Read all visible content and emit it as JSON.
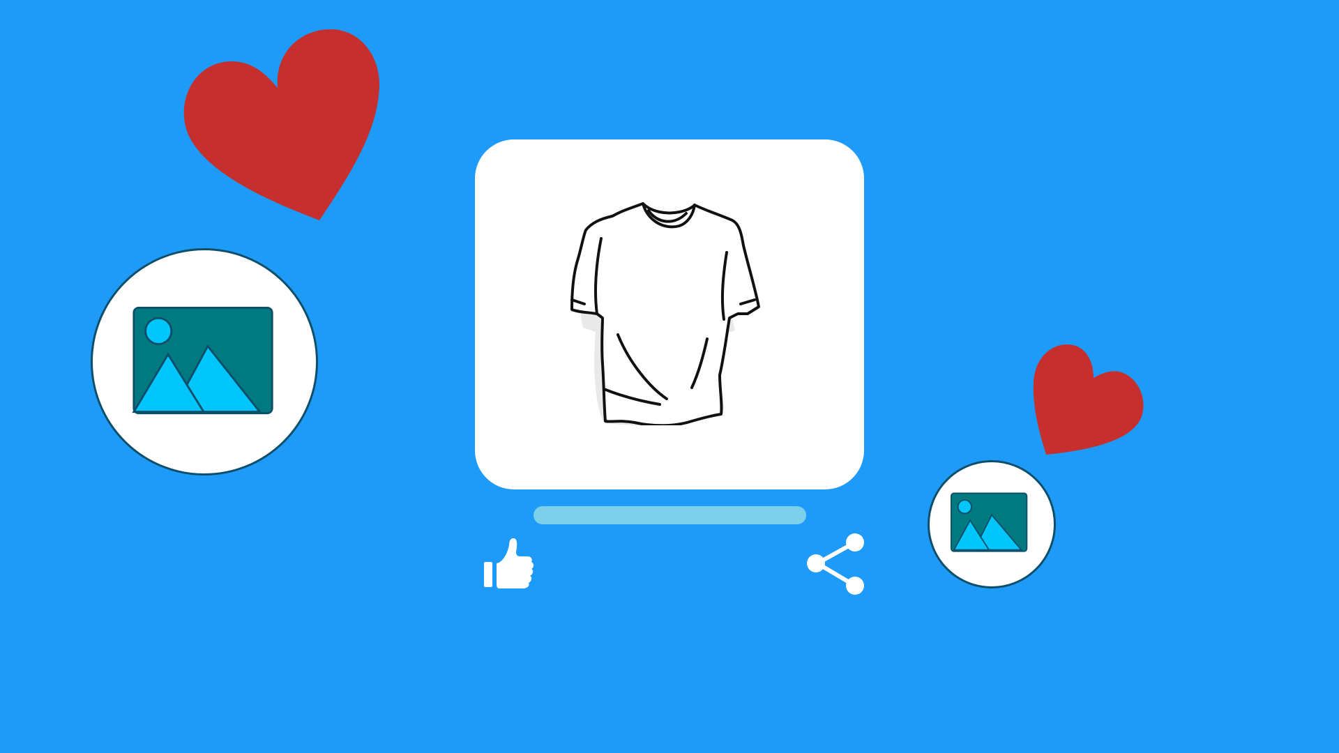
{
  "colors": {
    "background": "#1e9bf8",
    "heart": "#c5302f",
    "card": "#ffffff",
    "bubble_fill": "#ffffff",
    "bubble_border": "#0d4f6a",
    "image_frame": "#00797f",
    "image_accent": "#00c6fb",
    "caption_bar": "#7dd0ea",
    "icon_fill": "#ffffff",
    "tshirt_stroke": "#111111",
    "tshirt_shade": "#e9e9e9"
  },
  "icons": {
    "heart": "heart-icon",
    "image_placeholder": "image-icon",
    "tshirt": "tshirt-icon",
    "like": "thumbs-up-icon",
    "share": "share-icon"
  }
}
